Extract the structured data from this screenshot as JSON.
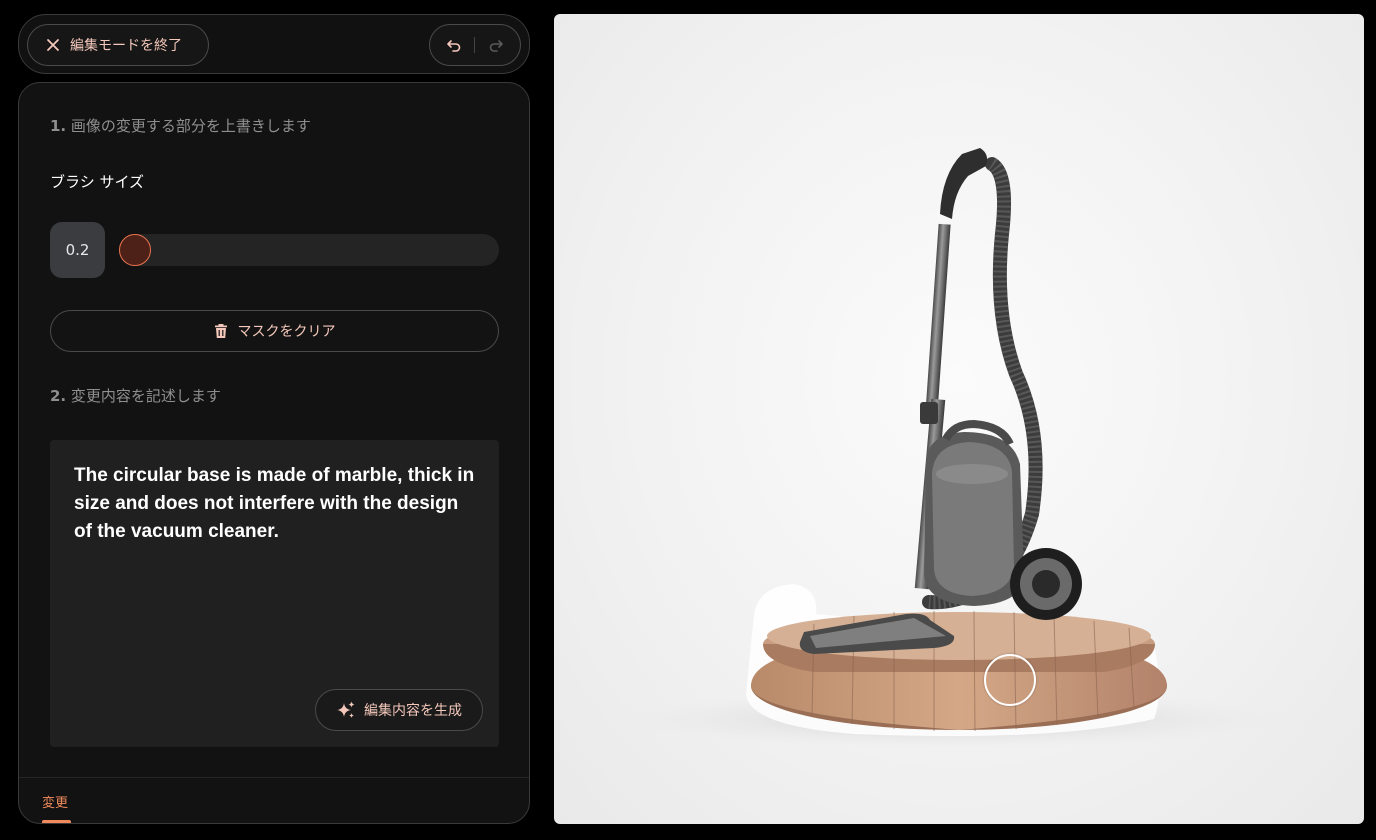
{
  "topbar": {
    "exit_label": "編集モードを終了",
    "exit_icon": "close-icon",
    "undo_icon": "undo-icon",
    "redo_icon": "redo-icon"
  },
  "panel": {
    "step1": {
      "num": "1.",
      "text": "画像の変更する部分を上書きします"
    },
    "brush_label": "ブラシ サイズ",
    "brush_value": "0.2",
    "brush_fraction": 0.0,
    "clear_label": "マスクをクリア",
    "step2": {
      "num": "2.",
      "text": "変更内容を記述します"
    },
    "prompt_value": "The circular base is made of marble, thick in size and does not interfere with the design of the vacuum cleaner.",
    "generate_label": "編集内容を生成",
    "tab_label": "変更"
  },
  "colors": {
    "accent": "#f08a5d",
    "button_text": "#f4c8bb",
    "thumb_fill": "#4d2117",
    "thumb_border": "#e8734d"
  }
}
